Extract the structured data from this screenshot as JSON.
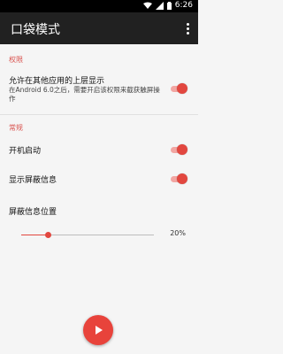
{
  "status_bar": {
    "time": "6:26"
  },
  "toolbar": {
    "title": "口袋模式",
    "overflow_icon": "more-vert-icon"
  },
  "sections": {
    "permissions": {
      "header": "权限",
      "overlay": {
        "title": "允许在其他应用的上层显示",
        "subtitle": "在Android 6.0之后，需要开启该权限来截获触屏操作",
        "enabled": true
      }
    },
    "general": {
      "header": "常规",
      "autostart": {
        "title": "开机启动",
        "enabled": true
      },
      "show_info": {
        "title": "显示屏蔽信息",
        "enabled": true
      },
      "info_position": {
        "title": "屏蔽信息位置",
        "value": 20,
        "value_label": "20%"
      }
    }
  },
  "fab": {
    "icon": "play-icon"
  },
  "colors": {
    "accent": "#e2473f",
    "toolbar": "#212121",
    "background": "#f5f5f5"
  }
}
